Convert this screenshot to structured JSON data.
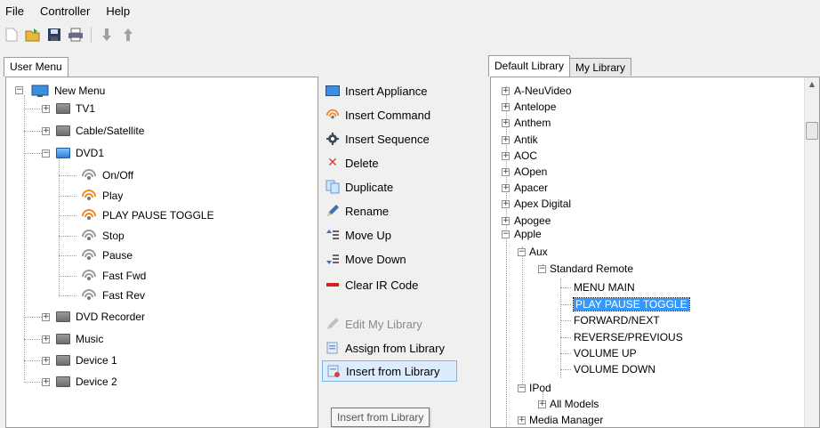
{
  "menubar": {
    "file": "File",
    "controller": "Controller",
    "help": "Help"
  },
  "toolbar": {
    "icons": [
      "new-document-icon",
      "open-folder-icon",
      "save-icon",
      "printer-icon",
      "download-arrow-icon",
      "upload-arrow-icon"
    ]
  },
  "left_panel": {
    "tab_label": "User Menu",
    "root": "New Menu",
    "nodes": {
      "tv1": "TV1",
      "cable": "Cable/Satellite",
      "dvd1": "DVD1",
      "dvd_recorder": "DVD Recorder",
      "music": "Music",
      "device1": "Device 1",
      "device2": "Device 2"
    },
    "dvd1_commands": [
      "On/Off",
      "Play",
      "PLAY PAUSE TOGGLE",
      "Stop",
      "Pause",
      "Fast Fwd",
      "Fast Rev"
    ]
  },
  "actions": {
    "insert_appliance": "Insert Appliance",
    "insert_command": "Insert Command",
    "insert_sequence": "Insert Sequence",
    "delete": "Delete",
    "duplicate": "Duplicate",
    "rename": "Rename",
    "move_up": "Move Up",
    "move_down": "Move Down",
    "clear_ir_code": "Clear IR Code",
    "edit_my_library": "Edit My Library",
    "assign_from_library": "Assign from Library",
    "insert_from_library": "Insert from Library",
    "tooltip": "Insert from Library"
  },
  "right_panel": {
    "tabs": [
      "Default Library",
      "My Library"
    ],
    "brands": [
      "A-NeuVideo",
      "Antelope",
      "Anthem",
      "Antik",
      "AOC",
      "AOpen",
      "Apacer",
      "Apex Digital",
      "Apogee",
      "Apple"
    ],
    "apple": {
      "aux": "Aux",
      "standard_remote": "Standard Remote",
      "commands": [
        "MENU MAIN",
        "PLAY PAUSE TOGGLE",
        "FORWARD/NEXT",
        "REVERSE/PREVIOUS",
        "VOLUME UP",
        "VOLUME DOWN"
      ],
      "selected_command": "PLAY PAUSE TOGGLE",
      "ipod": "IPod",
      "all_models": "All Models",
      "media_manager": "Media Manager"
    }
  },
  "colors": {
    "selection": "#3399ff",
    "hover_bg": "#dcecfc",
    "hover_border": "#7eb4ea",
    "clear_ir_red": "#d62020"
  }
}
